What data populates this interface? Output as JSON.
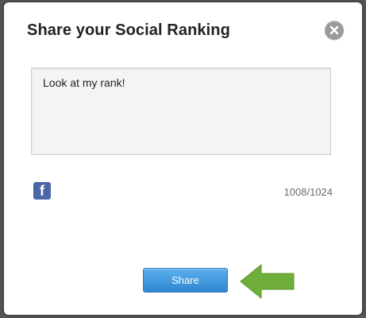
{
  "dialog": {
    "title": "Share your Social Ranking",
    "close_icon": "close-icon"
  },
  "message": {
    "value": "Look at my rank!"
  },
  "social": {
    "facebook_icon": "facebook-icon",
    "char_count": "1008/1024"
  },
  "actions": {
    "share_label": "Share",
    "arrow_icon": "arrow-left-icon",
    "arrow_color": "#6fae3a"
  },
  "colors": {
    "share_button": "#2f86d0",
    "facebook": "#4a67a8"
  }
}
